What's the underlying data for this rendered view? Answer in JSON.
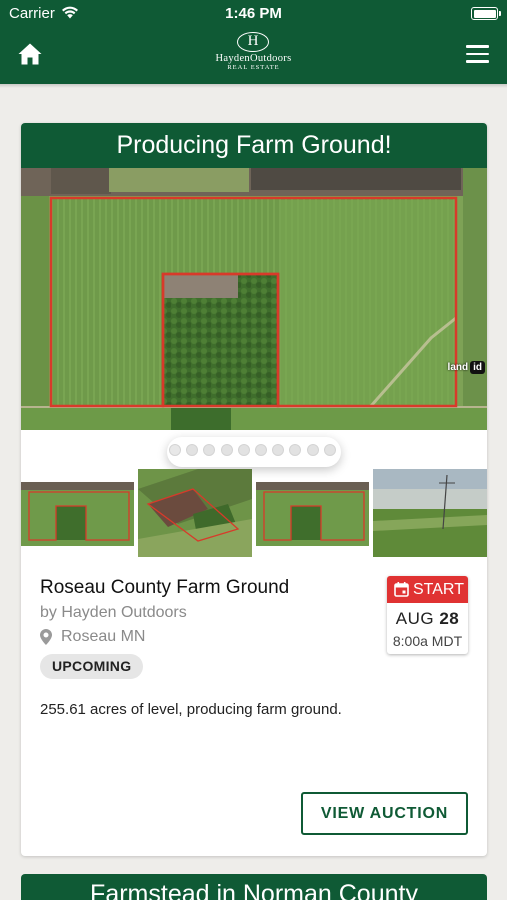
{
  "status_bar": {
    "carrier": "Carrier",
    "time": "1:46 PM"
  },
  "header": {
    "logo_mark": "H",
    "logo_name": "HaydenOutdoors",
    "logo_sub": "REAL ESTATE",
    "brand_color": "#0f5a35",
    "icons": {
      "left": "home-icon",
      "right": "hamburger-menu-icon"
    }
  },
  "listing": {
    "card_title": "Producing Farm Ground!",
    "hero_watermark": {
      "text": "land",
      "badge": "id"
    },
    "image_count": 10,
    "active_image": 1,
    "title": "Roseau County Farm Ground",
    "by": "by Hayden Outdoors",
    "location": "Roseau MN",
    "status": "UPCOMING",
    "description": "255.61 acres of level, producing farm ground.",
    "auction": {
      "label": "START",
      "month": "AUG",
      "day": "28",
      "time": "8:00a MDT",
      "accent_color": "#e03232"
    },
    "cta": "VIEW AUCTION"
  },
  "next_listing": {
    "card_title": "Farmstead in Norman County"
  }
}
